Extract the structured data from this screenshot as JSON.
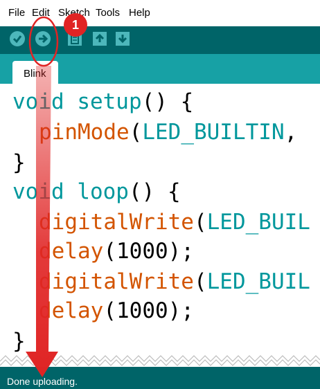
{
  "menu": [
    "File",
    "Edit",
    "Sketch",
    "Tools",
    "Help"
  ],
  "toolbar": {
    "verify_icon": "check-icon",
    "upload_icon": "arrow-right-icon",
    "new_icon": "file-icon",
    "open_icon": "arrow-up-icon",
    "save_icon": "arrow-down-icon"
  },
  "tab": {
    "label": "Blink"
  },
  "code": {
    "line1": {
      "kw": "void",
      "name": " setup",
      "rest": "() {"
    },
    "line2": {
      "fn": "pinMode",
      "open": "(",
      "const": "LED_BUILTIN",
      "rest": ","
    },
    "line3": {
      "text": "}"
    },
    "line4": {
      "kw": "void",
      "name": " loop",
      "rest": "() {"
    },
    "line5": {
      "fn": "digitalWrite",
      "open": "(",
      "const": "LED_BUIL"
    },
    "line6": {
      "fn": "delay",
      "open": "(",
      "num": "1000",
      "rest": ");"
    },
    "line7": {
      "fn": "digitalWrite",
      "open": "(",
      "const": "LED_BUIL"
    },
    "line8": {
      "fn": "delay",
      "open": "(",
      "num": "1000",
      "rest": ");"
    },
    "line9": {
      "text": "}"
    }
  },
  "status": {
    "text": "Done uploading."
  },
  "annotation": {
    "badge": "1"
  },
  "colors": {
    "toolbar": "#006468",
    "tabstrip": "#17a1a5",
    "keyword": "#00979c",
    "function": "#d35400",
    "annotation": "#e02424"
  }
}
